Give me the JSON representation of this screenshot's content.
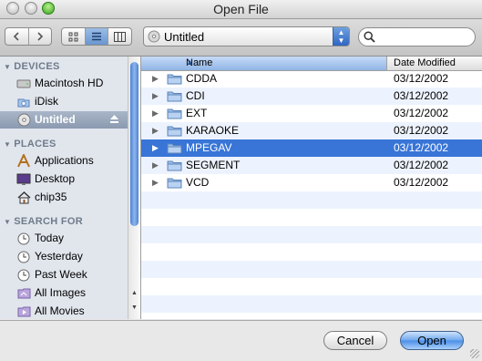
{
  "window": {
    "title": "Open File"
  },
  "toolbar": {
    "back_icon": "chevron-left-icon",
    "forward_icon": "chevron-right-icon",
    "view_modes": [
      "icon-view-icon",
      "list-view-icon",
      "column-view-icon"
    ],
    "selected_view": "list-view-icon",
    "location": "Untitled",
    "search": {
      "value": "",
      "placeholder": ""
    }
  },
  "sidebar": {
    "sections": [
      {
        "label": "DEVICES",
        "items": [
          {
            "label": "Macintosh HD",
            "icon": "hard-drive-icon"
          },
          {
            "label": "iDisk",
            "icon": "idisk-icon"
          },
          {
            "label": "Untitled",
            "icon": "disc-icon",
            "selected": true,
            "eject": true
          }
        ]
      },
      {
        "label": "PLACES",
        "items": [
          {
            "label": "Applications",
            "icon": "applications-icon"
          },
          {
            "label": "Desktop",
            "icon": "desktop-icon"
          },
          {
            "label": "chip35",
            "icon": "home-icon"
          }
        ]
      },
      {
        "label": "SEARCH FOR",
        "items": [
          {
            "label": "Today",
            "icon": "clock-icon"
          },
          {
            "label": "Yesterday",
            "icon": "clock-icon"
          },
          {
            "label": "Past Week",
            "icon": "clock-icon"
          },
          {
            "label": "All Images",
            "icon": "smart-folder-icon"
          },
          {
            "label": "All Movies",
            "icon": "smart-folder-icon"
          }
        ]
      }
    ]
  },
  "filelist": {
    "columns": [
      "Name",
      "Date Modified"
    ],
    "sort_column": "Name",
    "sort_direction": "ascending",
    "rows": [
      {
        "name": "CDDA",
        "date": "03/12/2002"
      },
      {
        "name": "CDI",
        "date": "03/12/2002"
      },
      {
        "name": "EXT",
        "date": "03/12/2002"
      },
      {
        "name": "KARAOKE",
        "date": "03/12/2002"
      },
      {
        "name": "MPEGAV",
        "date": "03/12/2002",
        "selected": true
      },
      {
        "name": "SEGMENT",
        "date": "03/12/2002"
      },
      {
        "name": "VCD",
        "date": "03/12/2002"
      }
    ]
  },
  "buttons": {
    "cancel": "Cancel",
    "open": "Open"
  },
  "colors": {
    "selection": "#3875d7",
    "sidebar_bg": "#e1e6ed",
    "default_button": "#4a8de6"
  }
}
